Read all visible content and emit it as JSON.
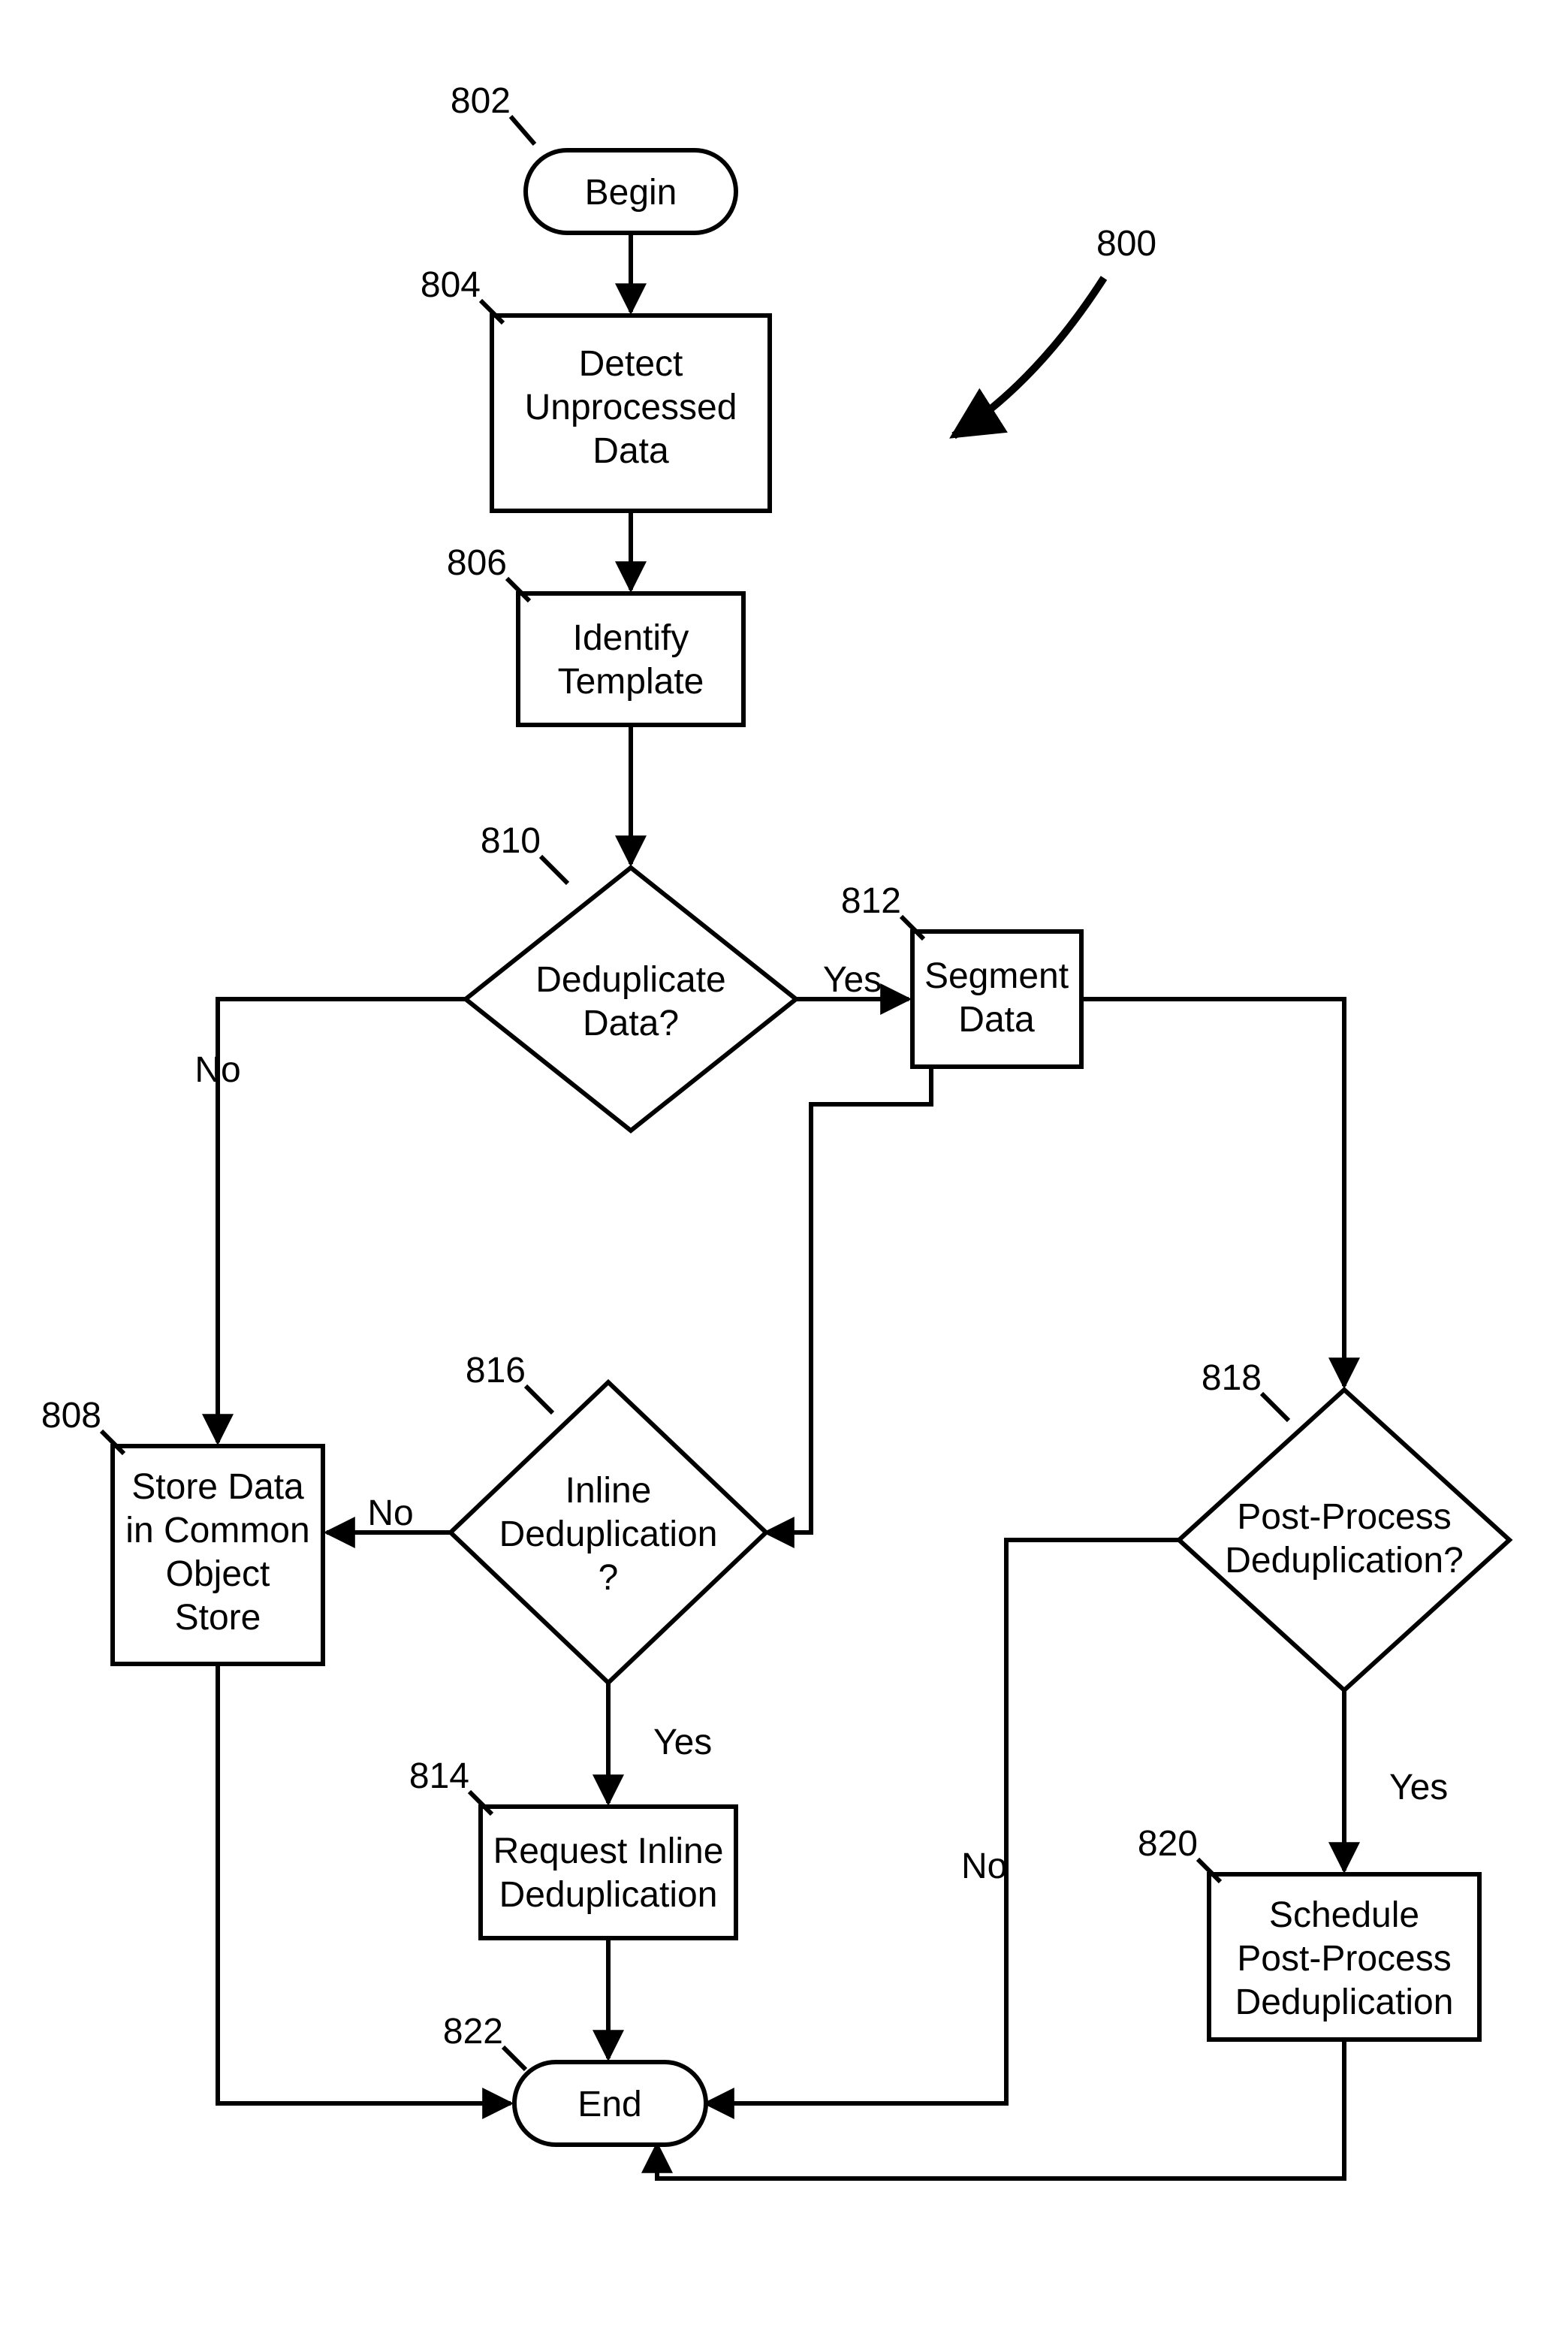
{
  "diagram": {
    "ref_number": {
      "num": "800"
    },
    "nodes": {
      "begin": {
        "num": "802",
        "label": "Begin"
      },
      "detect": {
        "num": "804",
        "label_l1": "Detect",
        "label_l2": "Unprocessed",
        "label_l3": "Data"
      },
      "identify": {
        "num": "806",
        "label_l1": "Identify",
        "label_l2": "Template"
      },
      "deduplicate": {
        "num": "810",
        "label_l1": "Deduplicate",
        "label_l2": "Data?"
      },
      "segment": {
        "num": "812",
        "label_l1": "Segment",
        "label_l2": "Data"
      },
      "store": {
        "num": "808",
        "label_l1": "Store Data",
        "label_l2": "in Common",
        "label_l3": "Object",
        "label_l4": "Store"
      },
      "inline": {
        "num": "816",
        "label_l1": "Inline",
        "label_l2": "Deduplication",
        "label_l3": "?"
      },
      "request_inline": {
        "num": "814",
        "label_l1": "Request Inline",
        "label_l2": "Deduplication"
      },
      "postprocess": {
        "num": "818",
        "label_l1": "Post-Process",
        "label_l2": "Deduplication?"
      },
      "schedule": {
        "num": "820",
        "label_l1": "Schedule",
        "label_l2": "Post-Process",
        "label_l3": "Deduplication"
      },
      "end": {
        "num": "822",
        "label": "End"
      }
    },
    "edges": {
      "dedup_yes": {
        "label": "Yes"
      },
      "dedup_no": {
        "label": "No"
      },
      "inline_yes": {
        "label": "Yes"
      },
      "inline_no": {
        "label": "No"
      },
      "post_yes": {
        "label": "Yes"
      },
      "post_no": {
        "label": "No"
      }
    }
  }
}
